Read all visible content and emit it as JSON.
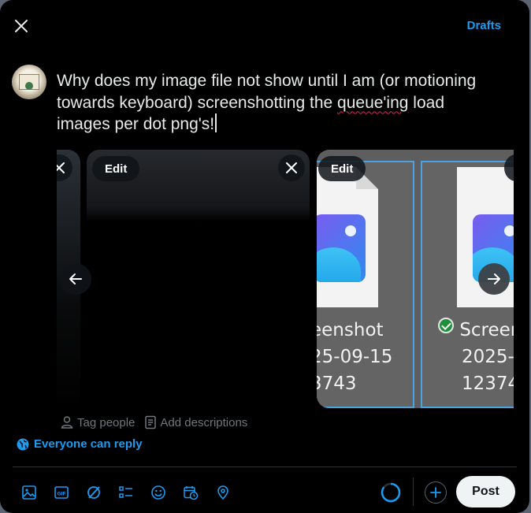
{
  "header": {
    "close_icon": "close-icon",
    "drafts_label": "Drafts"
  },
  "composer": {
    "text_part1": "Why does my image file not show until I am (or motioning towards keyboard) screenshotting the ",
    "text_misspelled": "queue'ing",
    "text_part2": " load images per dot png's!"
  },
  "media": {
    "edit_label": "Edit",
    "items": [
      {
        "kind": "dark-screenshot"
      },
      {
        "kind": "dark-screenshot"
      },
      {
        "kind": "file-explorer-thumbnails",
        "files": [
          {
            "name_lines": [
              "eenshot",
              "25-09-15",
              "3743"
            ],
            "status": ""
          },
          {
            "name_lines": [
              "Screen",
              "2025-(",
              "12374"
            ],
            "status": "check-icon"
          }
        ]
      }
    ]
  },
  "meta": {
    "tag_people": "Tag people",
    "add_descriptions": "Add descriptions"
  },
  "reply_setting": "Everyone can reply",
  "toolbar": {
    "icons": [
      "image-icon",
      "gif-icon",
      "grok-icon",
      "poll-icon",
      "emoji-icon",
      "schedule-icon",
      "location-icon"
    ],
    "post_label": "Post",
    "character_progress": 0.85
  },
  "colors": {
    "accent": "#1d9bf0",
    "background": "#000000",
    "post_button": "#eff3f4"
  }
}
